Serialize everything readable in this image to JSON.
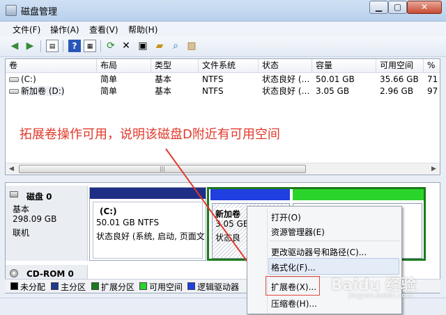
{
  "window": {
    "title": "磁盘管理",
    "controls": {
      "close": "✕"
    }
  },
  "menu": [
    "文件(F)",
    "操作(A)",
    "查看(V)",
    "帮助(H)"
  ],
  "toolbar_icons": [
    "back-arrow-icon",
    "forward-arrow-icon",
    "console-tree-icon",
    "help-icon",
    "properties-list-icon",
    "refresh-icon",
    "delete-x-icon",
    "properties-icon",
    "open-folder-icon",
    "search-icon",
    "export-icon"
  ],
  "volume_list": {
    "columns": [
      "卷",
      "布局",
      "类型",
      "文件系统",
      "状态",
      "容量",
      "可用空间",
      "%"
    ],
    "rows": [
      [
        "(C:)",
        "简单",
        "基本",
        "NTFS",
        "状态良好 (…",
        "50.01 GB",
        "35.66 GB",
        "71"
      ],
      [
        "新加卷 (D:)",
        "简单",
        "基本",
        "NTFS",
        "状态良好 (…",
        "3.05 GB",
        "2.96 GB",
        "97"
      ]
    ]
  },
  "annotation": "拓展卷操作可用，说明该磁盘D附近有可用空间",
  "disks": [
    {
      "name": "磁盘 0",
      "type": "基本",
      "size": "298.09 GB",
      "status": "联机",
      "volumes": [
        {
          "label": "(C:)",
          "size": "50.01 GB NTFS",
          "status": "状态良好 (系统, 启动, 页面文"
        },
        {
          "label": "新加卷",
          "size": "3.05 GB",
          "status": "状态良"
        }
      ]
    },
    {
      "name": "CD-ROM 0"
    }
  ],
  "legend": [
    {
      "label": "未分配",
      "color": "#000000"
    },
    {
      "label": "主分区",
      "color": "#1f3a8a"
    },
    {
      "label": "扩展分区",
      "color": "#1c7a1c"
    },
    {
      "label": "可用空间",
      "color": "#2bd42b"
    },
    {
      "label": "逻辑驱动器",
      "color": "#1f3fe0"
    }
  ],
  "context_menu": [
    "打开(O)",
    "资源管理器(E)",
    "更改驱动器号和路径(C)...",
    "格式化(F)...",
    "扩展卷(X)...",
    "压缩卷(H)..."
  ],
  "watermark": {
    "main": "Baidu 经验",
    "sub": "jingyan.baidu.com"
  }
}
